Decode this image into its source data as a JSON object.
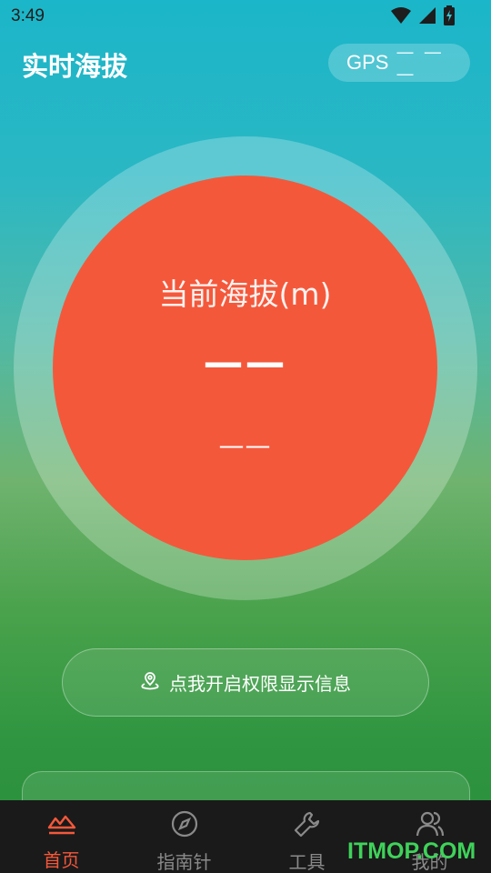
{
  "status_bar": {
    "time": "3:49",
    "icons": [
      "wifi-icon",
      "signal-icon",
      "battery-charging-icon"
    ]
  },
  "header": {
    "title": "实时海拔",
    "gps_label": "GPS",
    "gps_value": "— — —"
  },
  "altitude": {
    "label": "当前海拔(m)",
    "value": "——",
    "sub_value": "——"
  },
  "permission_button": {
    "label": "点我开启权限显示信息",
    "icon": "location-pin-icon"
  },
  "tabs": [
    {
      "label": "首页",
      "icon": "home-altitude-icon",
      "active": true
    },
    {
      "label": "指南针",
      "icon": "compass-icon",
      "active": false
    },
    {
      "label": "工具",
      "icon": "wrench-icon",
      "active": false
    },
    {
      "label": "我的",
      "icon": "users-icon",
      "active": false
    }
  ],
  "watermark": "ITMOP.COM",
  "colors": {
    "accent": "#f4583b",
    "tab_bar_bg": "#1a1a1a",
    "tab_inactive": "#8a8a8a",
    "watermark": "#3fd25a"
  }
}
